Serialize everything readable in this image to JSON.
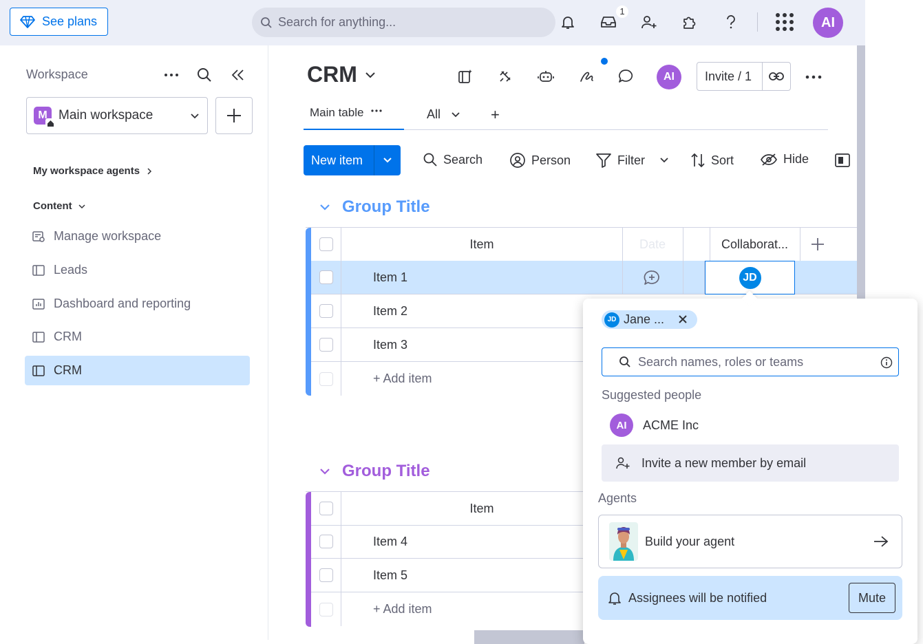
{
  "topbar": {
    "see_plans": "See plans",
    "search_placeholder": "Search for anything...",
    "inbox_count": "1",
    "user_initials": "AI",
    "colors": {
      "accent": "#0073ea",
      "avatar": "#a25ddc",
      "bg": "#eceff8"
    }
  },
  "sidebar": {
    "workspace_label": "Workspace",
    "workspace_name": "Main workspace",
    "workspace_logo": "M",
    "agents_heading": "My workspace agents",
    "content_heading": "Content",
    "items": [
      {
        "label": "Manage workspace",
        "icon": "manage-workspace-icon"
      },
      {
        "label": "Leads",
        "icon": "board-icon"
      },
      {
        "label": "Dashboard and reporting",
        "icon": "dashboard-icon"
      },
      {
        "label": "CRM",
        "icon": "board-icon"
      },
      {
        "label": "CRM",
        "icon": "board-icon",
        "active": true
      }
    ]
  },
  "board": {
    "title": "CRM",
    "user_initials": "AI",
    "invite_label": "Invite / 1",
    "tabs": {
      "main": "Main table",
      "all": "All",
      "add": "+"
    },
    "toolbar": {
      "new_item": "New item",
      "search": "Search",
      "person": "Person",
      "filter": "Filter",
      "sort": "Sort",
      "hide": "Hide"
    }
  },
  "groups": [
    {
      "title": "Group Title",
      "color": "#579bfc",
      "columns": {
        "item": "Item",
        "date": "Date",
        "collaborators": "Collaborat..."
      },
      "rows": [
        "Item 1",
        "Item 2",
        "Item 3"
      ],
      "add_item": "+ Add item",
      "collaborator_initials": "JD"
    },
    {
      "title": "Group Title",
      "color": "#a25ddc",
      "columns": {
        "item": "Item"
      },
      "rows": [
        "Item 4",
        "Item 5"
      ],
      "add_item": "+ Add item"
    }
  ],
  "popup": {
    "chip_initials": "JD",
    "chip_name": "Jane ...",
    "search_placeholder": "Search names, roles or teams",
    "suggested_heading": "Suggested people",
    "suggested": [
      {
        "initials": "AI",
        "name": "ACME Inc"
      }
    ],
    "invite_label": "Invite a new member by email",
    "agents_heading": "Agents",
    "build_agent": "Build your agent",
    "notify_text": "Assignees will be notified",
    "mute_label": "Mute"
  }
}
